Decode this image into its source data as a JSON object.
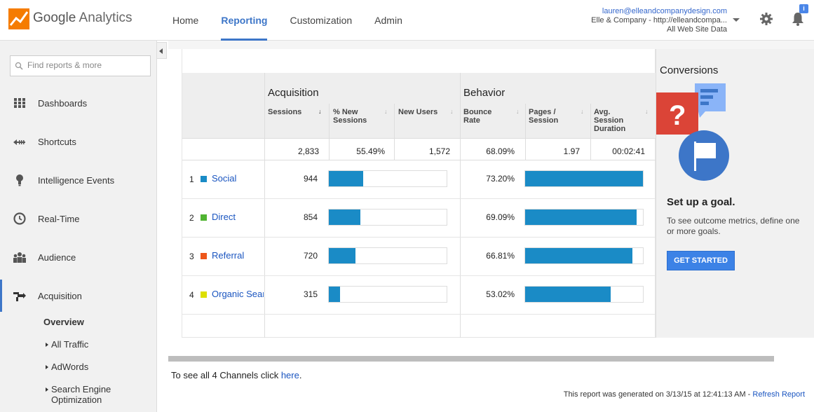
{
  "header": {
    "app_name_google": "Google",
    "app_name_rest": "Analytics",
    "nav": [
      {
        "label": "Home"
      },
      {
        "label": "Reporting"
      },
      {
        "label": "Customization"
      },
      {
        "label": "Admin"
      }
    ],
    "active_nav": "Reporting",
    "account_email": "lauren@elleandcompanydesign.com",
    "account_property": "Elle & Company - http://elleandcompa...",
    "account_view": "All Web Site Data",
    "notification_badge": "i"
  },
  "sidebar": {
    "search_placeholder": "Find reports & more",
    "items": [
      {
        "label": "Dashboards",
        "icon": "grid-icon"
      },
      {
        "label": "Shortcuts",
        "icon": "shortcut-arrow-icon"
      },
      {
        "label": "Intelligence Events",
        "icon": "lightbulb-icon"
      },
      {
        "label": "Real-Time",
        "icon": "clock-icon"
      },
      {
        "label": "Audience",
        "icon": "people-icon"
      },
      {
        "label": "Acquisition",
        "icon": "acquisition-arrows-icon"
      }
    ],
    "active_item": "Acquisition",
    "sub_items": [
      {
        "label": "Overview"
      },
      {
        "label": "All Traffic"
      },
      {
        "label": "AdWords"
      },
      {
        "label": "Search Engine"
      },
      {
        "label": "Optimization"
      }
    ]
  },
  "table": {
    "group_acquisition": "Acquisition",
    "group_behavior": "Behavior",
    "columns": [
      {
        "line1": "Sessions",
        "line2": "",
        "line3": ""
      },
      {
        "line1": "% New",
        "line2": "Sessions",
        "line3": ""
      },
      {
        "line1": "New Users",
        "line2": "",
        "line3": ""
      },
      {
        "line1": "Bounce",
        "line2": "Rate",
        "line3": ""
      },
      {
        "line1": "Pages /",
        "line2": "Session",
        "line3": ""
      },
      {
        "line1": "Avg.",
        "line2": "Session",
        "line3": "Duration"
      }
    ],
    "totals": [
      "2,833",
      "55.49%",
      "1,572",
      "68.09%",
      "1.97",
      "00:02:41"
    ],
    "rows": [
      {
        "num": "1",
        "channel": "Social",
        "color": "#1a8bc6",
        "sessions": "944",
        "sessions_bar": 0.293,
        "bounce": "73.20%",
        "bounce_bar": 1.0
      },
      {
        "num": "2",
        "channel": "Direct",
        "color": "#50b432",
        "sessions": "854",
        "sessions_bar": 0.265,
        "bounce": "69.09%",
        "bounce_bar": 0.944
      },
      {
        "num": "3",
        "channel": "Referral",
        "color": "#ed561b",
        "sessions": "720",
        "sessions_bar": 0.224,
        "bounce": "66.81%",
        "bounce_bar": 0.913
      },
      {
        "num": "4",
        "channel": "Organic Search",
        "color": "#dddf00",
        "sessions": "315",
        "sessions_bar": 0.098,
        "bounce": "53.02%",
        "bounce_bar": 0.724
      }
    ]
  },
  "conversions": {
    "title": "Conversions",
    "heading": "Set up a goal.",
    "description": "To see outcome metrics, define one or more goals.",
    "button": "GET STARTED"
  },
  "footer": {
    "see_all_prefix": "To see all 4 Channels click",
    "see_all_link": "here",
    "see_all_suffix": ".",
    "generated_text": "This report was generated on 3/13/15 at 12:41:13 AM -",
    "refresh_link": "Refresh Report"
  }
}
